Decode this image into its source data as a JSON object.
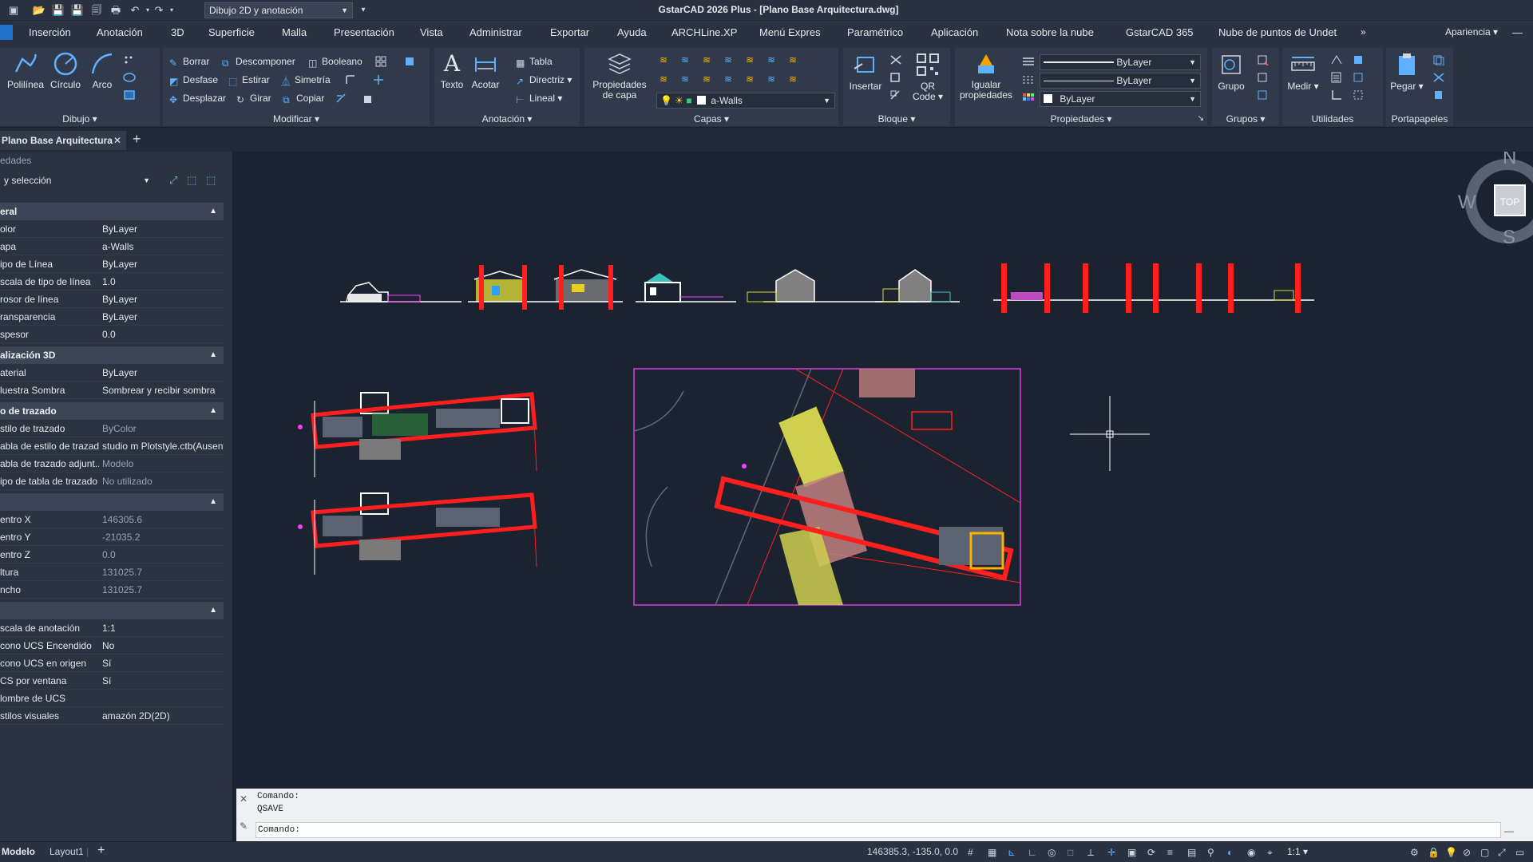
{
  "titlebar": {
    "workspace": "Dibujo 2D y anotación",
    "title": "GstarCAD 2026 Plus - [Plano Base Arquitectura.dwg]"
  },
  "ribbon_tabs": [
    "Inserción",
    "Anotación",
    "3D",
    "Superficie",
    "Malla",
    "Presentación",
    "Vista",
    "Administrar",
    "Exportar",
    "Ayuda",
    "ARCHLine.XP",
    "Menú Expres",
    "Paramétrico",
    "Aplicación",
    "Nota sobre la nube",
    "GstarCAD 365",
    "Nube de puntos de Undet"
  ],
  "apariencia": "Apariencia",
  "panels": {
    "dibujo": {
      "title": "Dibujo",
      "polilinea": "Polilínea",
      "circulo": "Círculo",
      "arco": "Arco"
    },
    "modificar": {
      "title": "Modificar",
      "borrar": "Borrar",
      "descomponer": "Descomponer",
      "booleano": "Booleano",
      "desfase": "Desfase",
      "estirar": "Estirar",
      "simetria": "Simetría",
      "desplazar": "Desplazar",
      "girar": "Girar",
      "copiar": "Copiar"
    },
    "anotacion": {
      "title": "Anotación",
      "texto": "Texto",
      "acotar": "Acotar",
      "tabla": "Tabla",
      "directriz": "Directriz",
      "lineal": "Lineal"
    },
    "capas": {
      "title": "Capas",
      "propiedades_line1": "Propiedades",
      "propiedades_line2": "de capa",
      "current_layer": "a-Walls"
    },
    "bloque": {
      "title": "Bloque",
      "insertar": "Insertar",
      "qr_line1": "QR",
      "qr_line2": "Code"
    },
    "propiedades": {
      "title": "Propiedades",
      "igualar_line1": "Igualar",
      "igualar_line2": "propiedades",
      "linetype": "ByLayer",
      "lineweight": "ByLayer",
      "color": "ByLayer"
    },
    "grupos": {
      "title": "Grupos",
      "grupo": "Grupo"
    },
    "utilidades": {
      "title": "Utilidades",
      "medir": "Medir"
    },
    "portapapeles": {
      "title": "Portapapeles",
      "pegar": "Pegar"
    }
  },
  "doc_tab": {
    "label": "Plano Base Arquitectura"
  },
  "properties_palette": {
    "header": "edades",
    "selection": "y selección",
    "sections": [
      {
        "title": "eral",
        "rows": [
          {
            "k": "olor",
            "v": "ByLayer"
          },
          {
            "k": "apa",
            "v": "a-Walls"
          },
          {
            "k": "ipo de Línea",
            "v": "ByLayer"
          },
          {
            "k": "scala de tipo de línea",
            "v": "1.0"
          },
          {
            "k": "rosor de línea",
            "v": "ByLayer"
          },
          {
            "k": "ransparencia",
            "v": "ByLayer"
          },
          {
            "k": "spesor",
            "v": "0.0"
          }
        ]
      },
      {
        "title": "alización 3D",
        "rows": [
          {
            "k": "aterial",
            "v": "ByLayer"
          },
          {
            "k": "luestra Sombra",
            "v": "Sombrear y recibir sombra"
          }
        ]
      },
      {
        "title": "o de trazado",
        "rows": [
          {
            "k": "stilo de trazado",
            "v": "ByColor"
          },
          {
            "k": "abla de estilo de trazado",
            "v": "studio m Plotstyle.ctb(Ausente)"
          },
          {
            "k": "abla de trazado adjunt...",
            "v": "Modelo"
          },
          {
            "k": "ipo de tabla de trazado",
            "v": "No utilizado"
          }
        ]
      },
      {
        "title": "",
        "rows": [
          {
            "k": "entro X",
            "v": "146305.6"
          },
          {
            "k": "entro Y",
            "v": "-21035.2"
          },
          {
            "k": "entro Z",
            "v": "0.0"
          },
          {
            "k": "ltura",
            "v": "131025.7"
          },
          {
            "k": "ncho",
            "v": "131025.7"
          }
        ]
      },
      {
        "title": "",
        "rows": [
          {
            "k": "scala de anotación",
            "v": "1:1"
          },
          {
            "k": "cono UCS Encendido",
            "v": "No"
          },
          {
            "k": "cono UCS en origen",
            "v": "Sí"
          },
          {
            "k": "CS por ventana",
            "v": "Sí"
          },
          {
            "k": "lombre de UCS",
            "v": ""
          },
          {
            "k": "stilos visuales",
            "v": "amazón 2D(2D)"
          }
        ]
      }
    ]
  },
  "viewcube": {
    "n": "N",
    "s": "S",
    "w": "W",
    "face": "TOP"
  },
  "command": {
    "line1": "Comando:",
    "line2": "QSAVE",
    "prompt": "Comando:"
  },
  "statusbar": {
    "model_tab": "Modelo",
    "layout_tab": "Layout1",
    "coords": "146385.3, -135.0, 0.0",
    "scale": "1:1"
  },
  "colors": {
    "accent": "#1f74c9",
    "canvas": "#1b2230",
    "walls": "#ff1f1f",
    "roof": "#c8c85a"
  }
}
